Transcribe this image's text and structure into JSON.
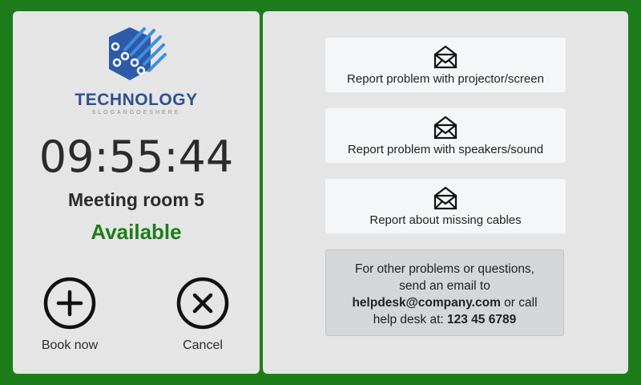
{
  "logo": {
    "name": "TECHNOLOGY",
    "slogan": "SLOGANGOESHERE",
    "color": "#2f4f8f"
  },
  "clock": {
    "time": "09:55:44"
  },
  "room": {
    "name": "Meeting room 5",
    "status": "Available",
    "status_color": "#1c7d1a"
  },
  "actions": {
    "book_label": "Book now",
    "book_icon": "plus-circle-icon",
    "cancel_label": "Cancel",
    "cancel_icon": "x-circle-icon"
  },
  "reports": [
    {
      "label": "Report problem with projector/screen",
      "icon": "envelope-open-icon"
    },
    {
      "label": "Report problem with speakers/sound",
      "icon": "envelope-open-icon"
    },
    {
      "label": "Report about missing cables",
      "icon": "envelope-open-icon"
    }
  ],
  "info": {
    "line1": "For other problems or questions,",
    "line2": "send an email to",
    "email": "helpdesk@company.com",
    "after_email": " or call",
    "phone_prefix": "help desk at: ",
    "phone": "123 45 6789"
  },
  "colors": {
    "background": "#1c7d1a",
    "panel": "#e5e5e5",
    "button": "#f5f6f8",
    "info_box": "#d5d6d8"
  }
}
